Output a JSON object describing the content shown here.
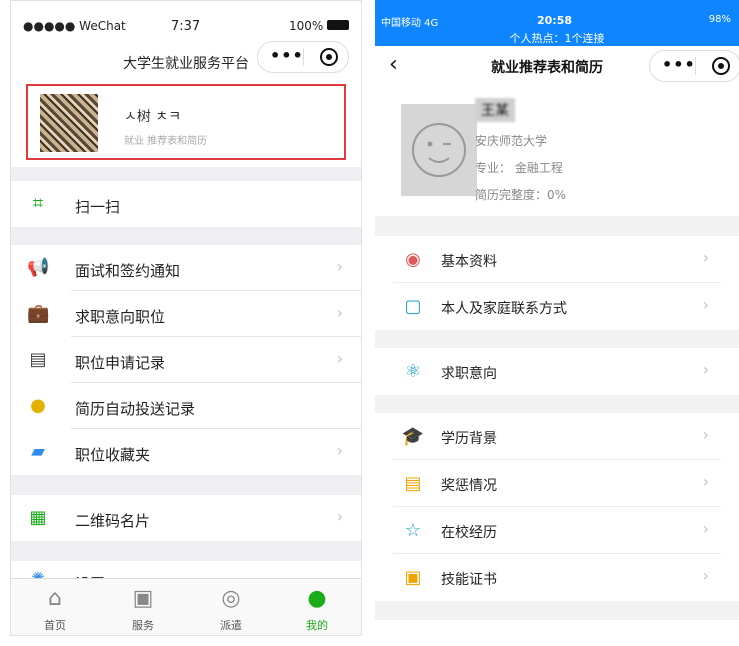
{
  "left": {
    "status": {
      "carrier": "●●●●● WeChat",
      "time": "7:37",
      "battery": "100%"
    },
    "title": "大学生就业服务平台",
    "profile": {
      "name": "ㅅ树 ㅊㅋ",
      "subtitle": "就业 推荐表和简历"
    },
    "scan": {
      "icon": "scan-icon",
      "label": "扫一扫"
    },
    "menu": [
      {
        "icon": "megaphone-icon",
        "label": "面试和签约通知"
      },
      {
        "icon": "briefcase-icon",
        "label": "求职意向职位"
      },
      {
        "icon": "document-icon",
        "label": "职位申请记录"
      },
      {
        "icon": "android-icon",
        "label": "简历自动投送记录"
      },
      {
        "icon": "folder-star-icon",
        "label": "职位收藏夹"
      }
    ],
    "qrcode": {
      "icon": "qrcode-icon",
      "label": "二维码名片"
    },
    "settings": {
      "icon": "gear-icon",
      "label": "设置"
    },
    "tabs": [
      {
        "icon": "home-icon",
        "label": "首页"
      },
      {
        "icon": "grid-icon",
        "label": "服务"
      },
      {
        "icon": "dispatch-icon",
        "label": "派遣"
      },
      {
        "icon": "person-icon",
        "label": "我的"
      }
    ],
    "accent": "#1aad19"
  },
  "right": {
    "status": {
      "carrier": "中国移动 4G",
      "time": "20:58",
      "battery": "98%",
      "hotspot": "个人热点：1个连接"
    },
    "title": "就业推荐表和简历",
    "profile": {
      "name": "王某",
      "school": "安庆师范大学",
      "major": "专业：  金融工程",
      "completeness": "简历完整度：0%"
    },
    "groups": [
      [
        {
          "icon": "id-badge-icon",
          "label": "基本资料"
        },
        {
          "icon": "contact-card-icon",
          "label": "本人及家庭联系方式"
        }
      ],
      [
        {
          "icon": "atom-icon",
          "label": "求职意向"
        }
      ],
      [
        {
          "icon": "graduation-cap-icon",
          "label": "学历背景"
        },
        {
          "icon": "award-icon",
          "label": "奖惩情况"
        },
        {
          "icon": "star-icon",
          "label": "在校经历"
        },
        {
          "icon": "certificate-icon",
          "label": "技能证书"
        }
      ]
    ],
    "accent": "#0f86ff"
  }
}
